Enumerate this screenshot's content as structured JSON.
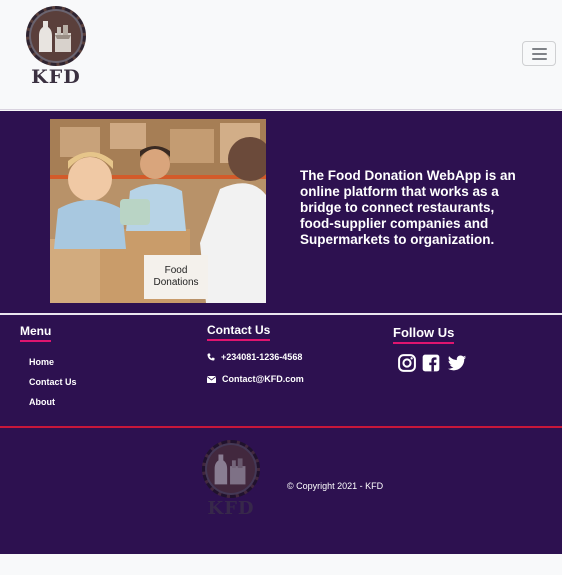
{
  "navbar": {
    "brand_text": "KFD",
    "toggler_icon": "hamburger-icon"
  },
  "hero": {
    "image_caption": "Food Donations",
    "description": "The Food Donation WebApp is an online platform that works as a bridge to connect restaurants, food-supplier companies and Supermarkets to organization."
  },
  "footer": {
    "menu": {
      "title": "Menu",
      "items": [
        {
          "label": "Home"
        },
        {
          "label": "Contact Us"
        },
        {
          "label": "About"
        }
      ]
    },
    "contact": {
      "title": "Contact Us",
      "phone": "+234081-1236-4568",
      "email": "Contact@KFD.com"
    },
    "follow": {
      "title": "Follow Us",
      "icons": [
        "instagram-icon",
        "facebook-icon",
        "twitter-icon"
      ]
    },
    "bottom": {
      "brand_text": "KFD",
      "copyright": "© Copyright 2021 - KFD"
    }
  },
  "colors": {
    "primary_purple": "#2d1150",
    "accent_pink": "#e0156f",
    "divider_red": "#c8173a",
    "navbar_bg": "#f8f9fa"
  }
}
